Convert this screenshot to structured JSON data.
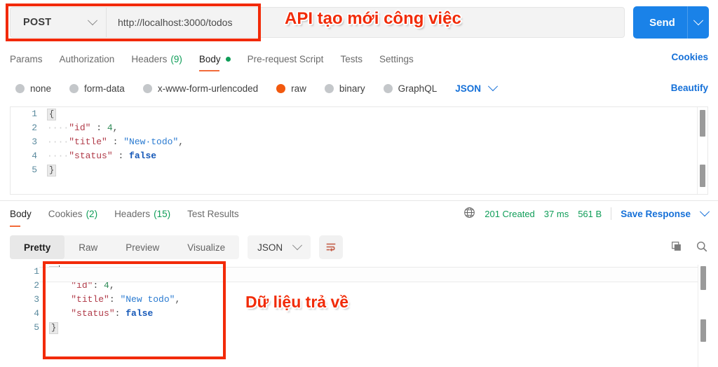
{
  "request": {
    "method": "POST",
    "url": "http://localhost:3000/todos",
    "send_label": "Send",
    "tabs": [
      {
        "label": "Params",
        "count": "",
        "active": false
      },
      {
        "label": "Authorization",
        "count": "",
        "active": false
      },
      {
        "label": "Headers",
        "count": "(9)",
        "active": false
      },
      {
        "label": "Body",
        "count": "",
        "active": true
      },
      {
        "label": "Pre-request Script",
        "count": "",
        "active": false
      },
      {
        "label": "Tests",
        "count": "",
        "active": false
      },
      {
        "label": "Settings",
        "count": "",
        "active": false
      }
    ],
    "cookies_link": "Cookies",
    "beautify_link": "Beautify",
    "body_types": [
      {
        "label": "none",
        "selected": false
      },
      {
        "label": "form-data",
        "selected": false
      },
      {
        "label": "x-www-form-urlencoded",
        "selected": false
      },
      {
        "label": "raw",
        "selected": true
      },
      {
        "label": "binary",
        "selected": false
      },
      {
        "label": "GraphQL",
        "selected": false
      }
    ],
    "raw_format": "JSON",
    "body_lines": [
      {
        "n": "1",
        "open_brace": "{"
      },
      {
        "n": "2",
        "indent": "····",
        "key": "\"id\"",
        "colon": " : ",
        "num": "4",
        "tail": ","
      },
      {
        "n": "3",
        "indent": "····",
        "key": "\"title\"",
        "colon": " : ",
        "str": "\"New·todo\"",
        "tail": ","
      },
      {
        "n": "4",
        "indent": "····",
        "key": "\"status\"",
        "colon": " : ",
        "bool": "false",
        "tail": ""
      },
      {
        "n": "5",
        "close_brace": "}"
      }
    ]
  },
  "response": {
    "tabs": [
      {
        "label": "Body",
        "count": "",
        "active": true
      },
      {
        "label": "Cookies",
        "count": "(2)",
        "active": false
      },
      {
        "label": "Headers",
        "count": "(15)",
        "active": false
      },
      {
        "label": "Test Results",
        "count": "",
        "active": false
      }
    ],
    "status": "201 Created",
    "time": "37 ms",
    "size": "561 B",
    "save_label": "Save Response",
    "view_modes": [
      {
        "label": "Pretty",
        "active": true
      },
      {
        "label": "Raw",
        "active": false
      },
      {
        "label": "Preview",
        "active": false
      },
      {
        "label": "Visualize",
        "active": false
      }
    ],
    "format": "JSON",
    "body_lines": [
      {
        "n": "1",
        "open_brace": "{"
      },
      {
        "n": "2",
        "indent": "    ",
        "key": "\"id\"",
        "colon": ": ",
        "num": "4",
        "tail": ","
      },
      {
        "n": "3",
        "indent": "    ",
        "key": "\"title\"",
        "colon": ": ",
        "str": "\"New todo\"",
        "tail": ","
      },
      {
        "n": "4",
        "indent": "    ",
        "key": "\"status\"",
        "colon": ": ",
        "bool": "false",
        "tail": ""
      },
      {
        "n": "5",
        "close_brace": "}"
      }
    ]
  },
  "annotations": {
    "api_note": "API tạo mới công việc",
    "response_note": "Dữ liệu trả về"
  },
  "colors": {
    "accent_orange": "#f26b3a",
    "send_blue": "#1a82e8",
    "link_blue": "#1570d8",
    "status_green": "#0f9d58",
    "annotation_red": "#f22a08"
  }
}
